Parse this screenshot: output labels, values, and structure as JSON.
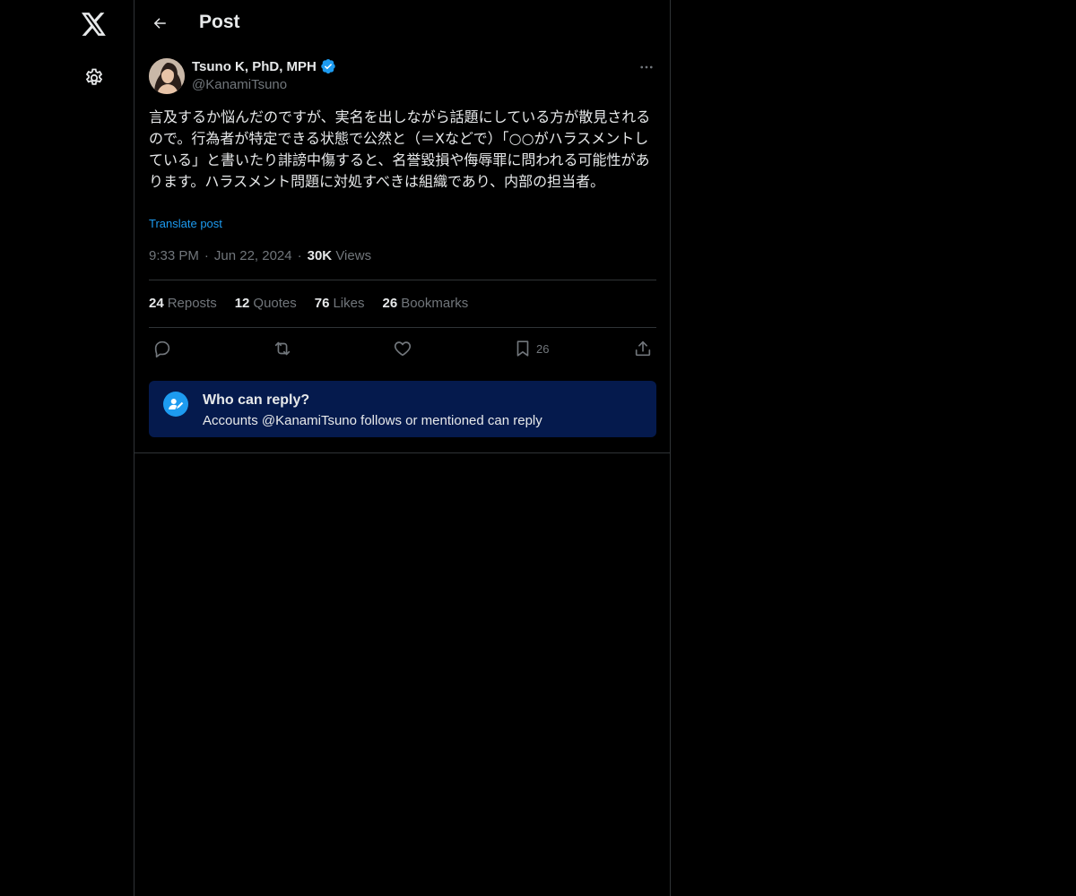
{
  "nav": {
    "logo_icon": "x-logo-icon",
    "settings_icon": "gear-icon"
  },
  "header": {
    "title": "Post",
    "back_icon": "arrow-left-icon"
  },
  "post": {
    "author_name": "Tsuno K, PhD, MPH",
    "verified": true,
    "handle": "@KanamiTsuno",
    "text": "言及するか悩んだのですが、実名を出しながら話題にしている方が散見されるので。行為者が特定できる状態で公然と（＝Xなどで）「○○がハラスメントしている」と書いたり誹謗中傷すると、名誉毀損や侮辱罪に問われる可能性があります。ハラスメント問題に対処すべきは組織であり、内部の担当者。",
    "translate_label": "Translate post",
    "time": "9:33 PM",
    "date": "Jun 22, 2024",
    "views_count": "30K",
    "views_label": "Views"
  },
  "stats": {
    "reposts_count": "24",
    "reposts_label": "Reposts",
    "quotes_count": "12",
    "quotes_label": "Quotes",
    "likes_count": "76",
    "likes_label": "Likes",
    "bookmarks_count": "26",
    "bookmarks_label": "Bookmarks"
  },
  "actions": {
    "reply_icon": "reply-icon",
    "repost_icon": "repost-icon",
    "like_icon": "heart-icon",
    "bookmark_icon": "bookmark-icon",
    "bookmark_count": "26",
    "share_icon": "share-icon"
  },
  "reply_restriction": {
    "title": "Who can reply?",
    "subtitle": "Accounts @KanamiTsuno follows or mentioned can reply"
  },
  "colors": {
    "background": "#000000",
    "accent": "#1d9bf0",
    "muted_text": "#71767b",
    "primary_text": "#e7e9ea",
    "divider": "#2f3336",
    "reply_box": "#051a4d"
  }
}
